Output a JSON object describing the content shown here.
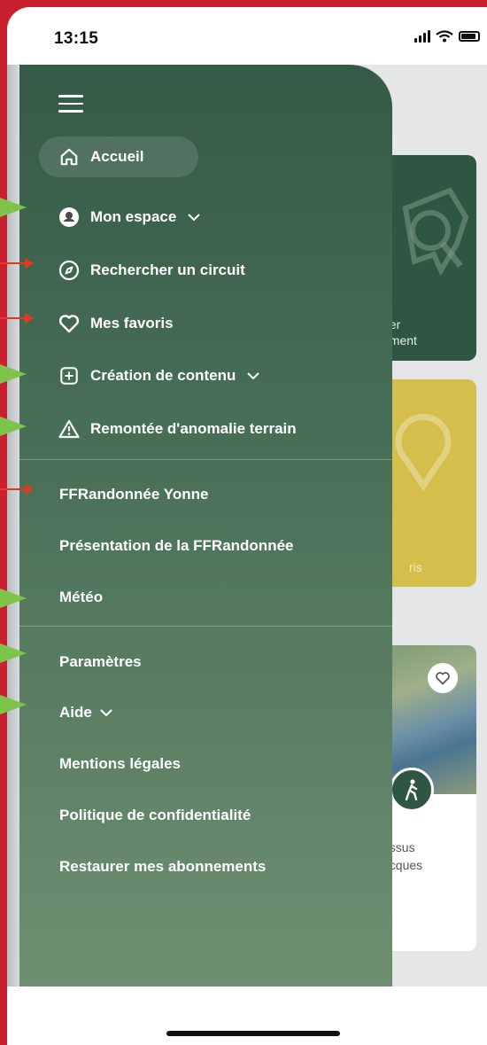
{
  "status_bar": {
    "time": "13:15"
  },
  "background": {
    "card_1_text_line1": "her",
    "card_1_text_line2": "ement",
    "card_2_text": "ris",
    "card_3_text_line1": "essus",
    "card_3_text_line2": "acques"
  },
  "drawer": {
    "primary_items": [
      {
        "label": "Accueil",
        "icon": "home-icon"
      },
      {
        "label": "Mon espace",
        "icon": "avatar-icon",
        "expandable": true
      },
      {
        "label": "Rechercher un circuit",
        "icon": "compass-icon"
      },
      {
        "label": "Mes favoris",
        "icon": "heart-icon"
      },
      {
        "label": "Création de contenu",
        "icon": "plus-square-icon",
        "expandable": true
      },
      {
        "label": "Remontée d'anomalie terrain",
        "icon": "warning-icon"
      }
    ],
    "federation_items": [
      {
        "label": "FFRandonnée Yonne"
      },
      {
        "label": "Présentation de la FFRandonnée"
      },
      {
        "label": "Météo"
      }
    ],
    "settings_items": [
      {
        "label": "Paramètres"
      },
      {
        "label": "Aide",
        "expandable": true
      },
      {
        "label": "Mentions légales"
      },
      {
        "label": "Politique de confidentialité"
      },
      {
        "label": "Restaurer mes abonnements"
      }
    ]
  },
  "colors": {
    "drawer_top": "#355a47",
    "drawer_bottom": "#6f8f72",
    "frame_red": "#c8202e",
    "annotation_green": "#7ec34a",
    "annotation_red": "#e4381f",
    "card_yellow": "#d4bf4c"
  }
}
